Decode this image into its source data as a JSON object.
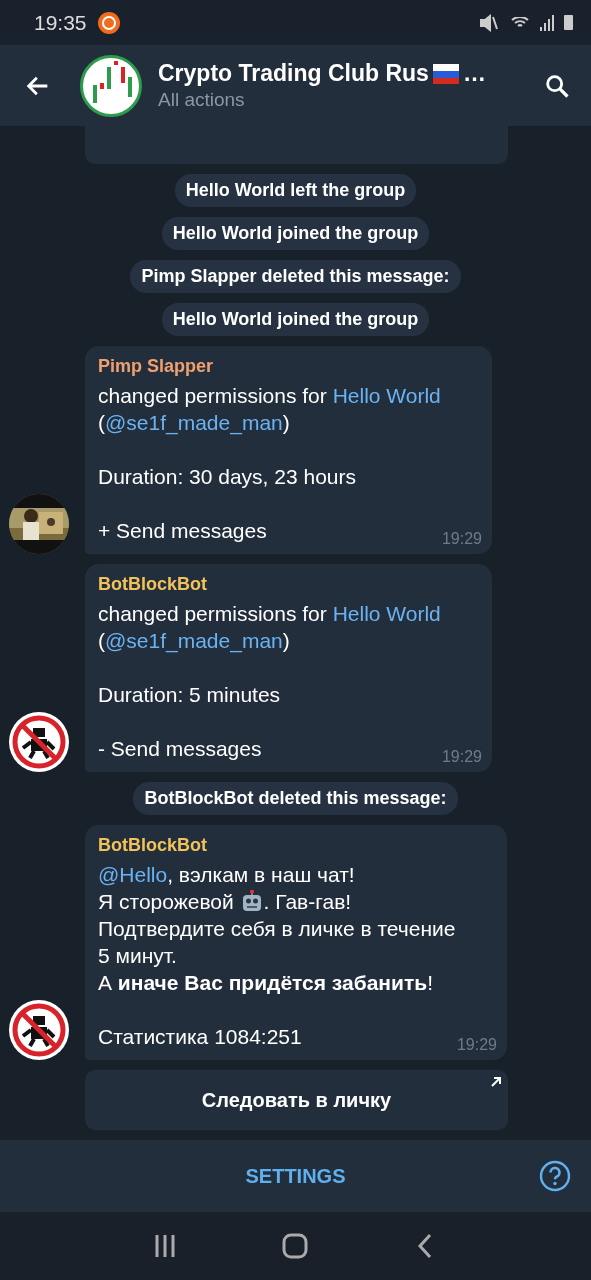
{
  "status_bar": {
    "time": "19:35"
  },
  "header": {
    "title": "Crypto Trading Club Rus",
    "title_suffix": "…",
    "subtitle": "All actions"
  },
  "feed": [
    {
      "kind": "stub"
    },
    {
      "kind": "service",
      "text": "Hello World left the group"
    },
    {
      "kind": "service",
      "text": "Hello World joined the group"
    },
    {
      "kind": "service",
      "text": "Pimp Slapper deleted this message:"
    },
    {
      "kind": "service",
      "text": "Hello World joined the group"
    },
    {
      "kind": "message",
      "sender": "Pimp Slapper",
      "color": "#f0a070",
      "avatar": {
        "kind": "picture"
      },
      "time": "19:29",
      "paragraphs": [
        [
          {
            "kind": "text",
            "text": "changed permissions for "
          },
          {
            "kind": "link",
            "text": "Hello World"
          },
          {
            "kind": "text",
            "text": "\n("
          },
          {
            "kind": "link",
            "text": "@se1f_made_man"
          },
          {
            "kind": "text",
            "text": ")"
          }
        ],
        [
          {
            "kind": "text",
            "text": "Duration: 30 days, 23 hours"
          }
        ],
        [
          {
            "kind": "text",
            "text": "+ Send messages"
          }
        ]
      ]
    },
    {
      "kind": "message",
      "sender": "BotBlockBot",
      "color": "#f2c35a",
      "avatar": {
        "kind": "blocked"
      },
      "time": "19:29",
      "paragraphs": [
        [
          {
            "kind": "text",
            "text": "changed permissions for "
          },
          {
            "kind": "link",
            "text": "Hello World"
          },
          {
            "kind": "text",
            "text": "\n("
          },
          {
            "kind": "link",
            "text": "@se1f_made_man"
          },
          {
            "kind": "text",
            "text": ")"
          }
        ],
        [
          {
            "kind": "text",
            "text": "Duration: 5 minutes"
          }
        ],
        [
          {
            "kind": "text",
            "text": "- Send messages"
          }
        ]
      ]
    },
    {
      "kind": "service",
      "text": "BotBlockBot deleted this message:"
    },
    {
      "kind": "message",
      "sender": "BotBlockBot",
      "color": "#f2c35a",
      "avatar": {
        "kind": "blocked"
      },
      "time": "19:29",
      "paragraphs": [
        [
          {
            "kind": "link",
            "text": "@Hello"
          },
          {
            "kind": "text",
            "text": ", вэлкам в наш чат!\nЯ сторожевой "
          },
          {
            "kind": "emoji"
          },
          {
            "kind": "text",
            "text": ". Гав-гав!\nПодтвердите себя в личке в течение\n5 минут.\nА **иначе Вас придётся забанить**!"
          }
        ],
        [
          {
            "kind": "text",
            "text": "Статистика 1084:251"
          }
        ]
      ]
    },
    {
      "kind": "button",
      "label": "Следовать в личку"
    }
  ],
  "bottom_bar": {
    "label": "SETTINGS"
  }
}
